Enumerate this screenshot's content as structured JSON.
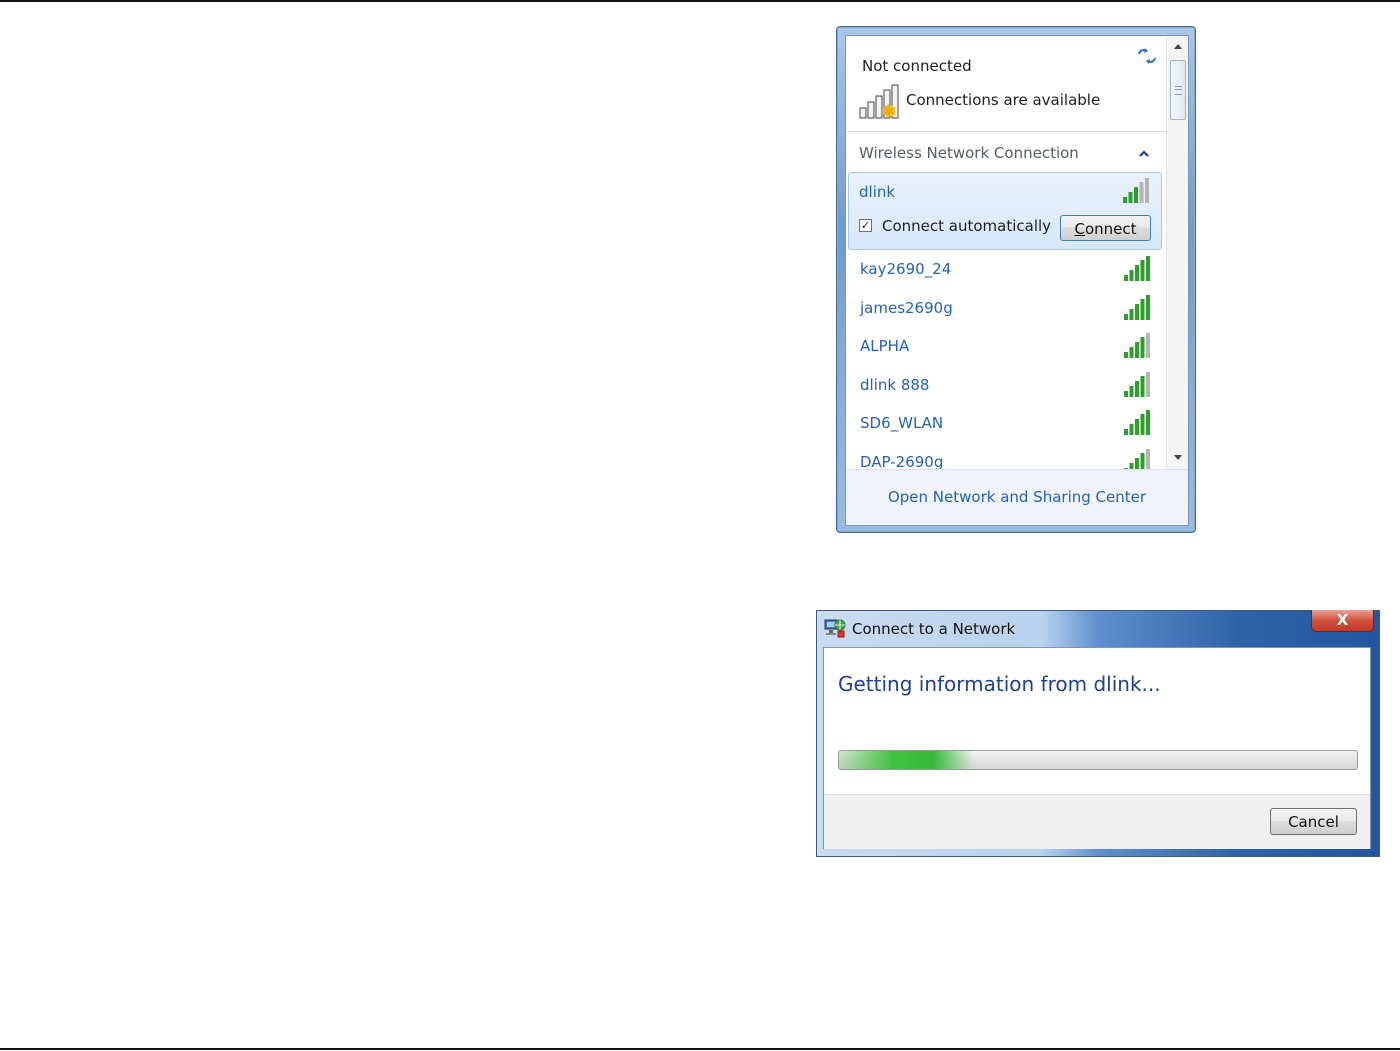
{
  "flyout": {
    "status_title": "Not connected",
    "status_text": "Connections are available",
    "section_header": "Wireless Network Connection",
    "selected_network": {
      "name": "dlink",
      "connect_automatically_label": "Connect automatically",
      "connect_automatically_checked": true,
      "connect_button_mnemonic": "C",
      "connect_button_rest": "onnect",
      "signal_bars": 3
    },
    "networks": [
      {
        "name": "kay2690_24",
        "signal_bars": 5
      },
      {
        "name": "james2690g",
        "signal_bars": 5
      },
      {
        "name": "ALPHA",
        "signal_bars": 4
      },
      {
        "name": "dlink 888",
        "signal_bars": 4
      },
      {
        "name": "SD6_WLAN",
        "signal_bars": 5
      },
      {
        "name": "DAP-2690g",
        "signal_bars": 4
      }
    ],
    "footer_link": "Open Network and Sharing Center"
  },
  "dialog": {
    "title": "Connect to a Network",
    "close_label": "X",
    "message": "Getting information from dlink...",
    "progress": 0.26,
    "cancel_label": "Cancel"
  },
  "colors": {
    "link_blue": "#2462b3",
    "signal_green": "#2f9e2f",
    "signal_gray": "#b4b4b4",
    "dialog_message": "#1f3f8f"
  }
}
